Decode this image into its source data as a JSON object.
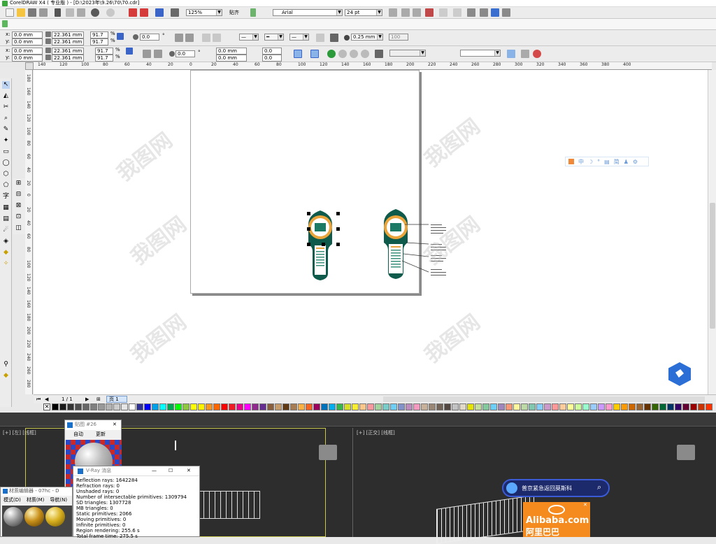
{
  "window": {
    "title": "CorelDRAW X4 ( 专业版 ) - [D:\\2023年\\9.26\\70\\70.cdr]"
  },
  "standard_toolbar": {
    "zoom": "125%",
    "snap": "贴齐",
    "font_name": "Arial",
    "font_size": "24 pt"
  },
  "property_bar1": {
    "x": "0.0 mm",
    "y": "0.0 mm",
    "w": "22.361 mm",
    "h": "22.361 mm",
    "scale_w": "91.7",
    "scale_h": "91.7",
    "pct": "%",
    "rotation": "0.0",
    "deg": "°",
    "outline_width": "0.25 mm",
    "count": "100"
  },
  "property_bar2": {
    "x": "0.0 mm",
    "y": "0.0 mm",
    "w": "22.361 mm",
    "h": "22.361 mm",
    "scale_w": "91.7",
    "scale_h": "91.7",
    "pct": "%",
    "rotation": "0.0",
    "deg": "°",
    "pos_x": "0.0 mm",
    "pos_y": "0.0 mm",
    "ox": "0.0",
    "oy": "0.0"
  },
  "ruler_h": [
    "140",
    "120",
    "100",
    "80",
    "60",
    "40",
    "20",
    "0",
    "20",
    "40",
    "60",
    "80",
    "100",
    "120",
    "140",
    "160",
    "180",
    "200",
    "220",
    "240",
    "260",
    "280",
    "300",
    "320",
    "340",
    "360",
    "380",
    "400"
  ],
  "ruler_v": [
    "180",
    "160",
    "140",
    "120",
    "100",
    "80",
    "60",
    "40",
    "20",
    "0",
    "20",
    "40",
    "60",
    "80",
    "100",
    "120",
    "140",
    "160",
    "180",
    "200",
    "220",
    "240",
    "260",
    "280"
  ],
  "status": {
    "page_count": "1 / 1",
    "page_tab": "页 1"
  },
  "ime_toolbar": {
    "lang": "中",
    "simplified": "简"
  },
  "watermark": {
    "text": "我图网"
  },
  "palette": [
    "#000000",
    "#1a1a1a",
    "#333333",
    "#4d4d4d",
    "#666666",
    "#808080",
    "#999999",
    "#b3b3b3",
    "#cccccc",
    "#e6e6e6",
    "#ffffff",
    "#2e3192",
    "#0000ff",
    "#00a0e9",
    "#00ffff",
    "#00a651",
    "#00ff00",
    "#8dc63f",
    "#ffff00",
    "#fff200",
    "#f7941d",
    "#ff6600",
    "#ff0000",
    "#ed1c24",
    "#ec008c",
    "#ff00ff",
    "#92278f",
    "#662d91",
    "#8b5e3c",
    "#c69c6d",
    "#603913",
    "#a67c52",
    "#fbb040",
    "#f26522",
    "#9e005d",
    "#0072bc",
    "#00aeef",
    "#39b54a",
    "#d7df23",
    "#f9ed32",
    "#fdc689",
    "#f6989d",
    "#a3d39c",
    "#7accc8",
    "#6dcff6",
    "#8393ca",
    "#bd8cbf",
    "#f49ac1",
    "#c7b299",
    "#998675",
    "#736357",
    "#534741",
    "#c2c2c2",
    "#e0d9c7",
    "#e4e400",
    "#c4df9b",
    "#82ca9c",
    "#6ecff6",
    "#a186be",
    "#f7977a",
    "#fff799",
    "#bcd9a6",
    "#7fc7af",
    "#87cefa",
    "#cc99cc",
    "#ff9999",
    "#ffcc99",
    "#ffff99",
    "#ccff99",
    "#99ffcc",
    "#99ccff",
    "#cc99ff",
    "#ff99cc",
    "#ffcc00",
    "#ff9900",
    "#cc6600",
    "#996633",
    "#663300",
    "#336600",
    "#006633",
    "#003366",
    "#330066",
    "#660033",
    "#990000",
    "#cc3300",
    "#ff3300",
    "#ff6699",
    "#ff66cc",
    "#cc66ff",
    "#6666ff"
  ],
  "max": {
    "viewport_left_label": "[+] [左] [线框]",
    "viewport_right_label": "[+] [正交] [线框]",
    "texture_window_title": "贴图 #26",
    "auto_label": "自动",
    "update_label": "更新",
    "material_editor_title": "材质编辑器 - 07hc - D",
    "material_menu": [
      "模式(D)",
      "材质(M)",
      "导航(N)"
    ],
    "vray_title": "V-Ray 消息",
    "vray_lines": [
      "Reflection rays: 1642284",
      "Refraction rays: 0",
      "Unshaded rays: 0",
      "Number of intersectable primitives: 1309794",
      "SD triangles: 1307728",
      "MB triangles: 0",
      "Static primitives: 2066",
      "Moving primitives: 0",
      "Infinite primitives: 0",
      "Region rendering: 255.6 s",
      "Total frame time: 275.5 s"
    ],
    "search_text": "普京紧急返回莫斯科",
    "ad_brand": "Alibaba.com",
    "ad_sub": "阿里巴巴"
  }
}
